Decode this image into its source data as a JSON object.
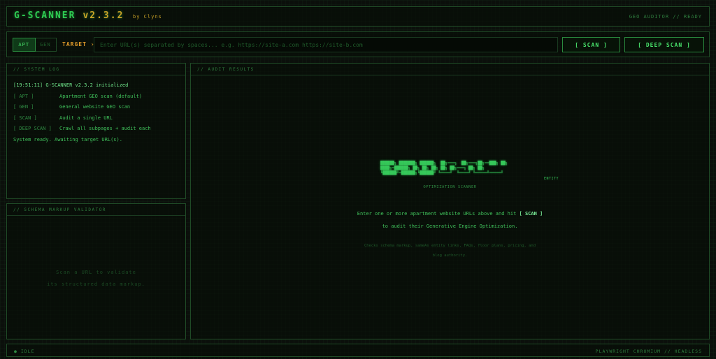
{
  "header": {
    "title": "G-SCANNER",
    "version": "v2.3.2",
    "author": "by Clyns",
    "status": "GEO AUDITOR // READY"
  },
  "command_bar": {
    "modes": [
      {
        "label": "APT",
        "active": true
      },
      {
        "label": "GEN",
        "active": false
      }
    ],
    "target_label": "TARGET ›",
    "url_placeholder": "Enter URL(s) separated by spaces... e.g. https://site-a.com https://site-b.com",
    "url_value": "",
    "scan_label": "[ SCAN ]",
    "deep_scan_label": "[ DEEP SCAN ]"
  },
  "system_log": {
    "title": "// SYSTEM LOG",
    "init_line": "[19:51:11] G-SCANNER v2.3.2 initialized",
    "entries": [
      {
        "tag": "[ APT ]",
        "text": "Apartment GEO scan (default)"
      },
      {
        "tag": "[ GEN ]",
        "text": "General website GEO scan"
      },
      {
        "tag": "[ SCAN ]",
        "text": "Audit a single URL"
      },
      {
        "tag": "[ DEEP SCAN ]",
        "text": "Crawl all subpages + audit each"
      }
    ],
    "ready_line": "System ready. Awaiting target URL(s)."
  },
  "schema_validator": {
    "title": "// SCHEMA MARKUP VALIDATOR",
    "empty_line1": "Scan a URL to validate",
    "empty_line2": "its structured data markup."
  },
  "audit_results": {
    "title": "// AUDIT RESULTS",
    "logo_word": "ENTITY",
    "logo_subtitle": "OPTIMIZATION SCANNER",
    "msg_line1_pre": "Enter one or more apartment website URLs above and hit ",
    "msg_line1_key": "[ SCAN ]",
    "msg_line2": "to audit their Generative Engine Optimization.",
    "desc_line1": "Checks schema markup, sameAs entity links, FAQs, floor plans, pricing, and",
    "desc_line2": "blog authority."
  },
  "footer": {
    "status_dot": "●",
    "status": "IDLE",
    "engine": "PLAYWRIGHT CHROMIUM // HEADLESS"
  },
  "colors": {
    "accent": "#2ecc52",
    "gold": "#c9a227",
    "target_orange": "#e09a2a",
    "background": "#0b0f0b",
    "border": "#1f4a26"
  }
}
